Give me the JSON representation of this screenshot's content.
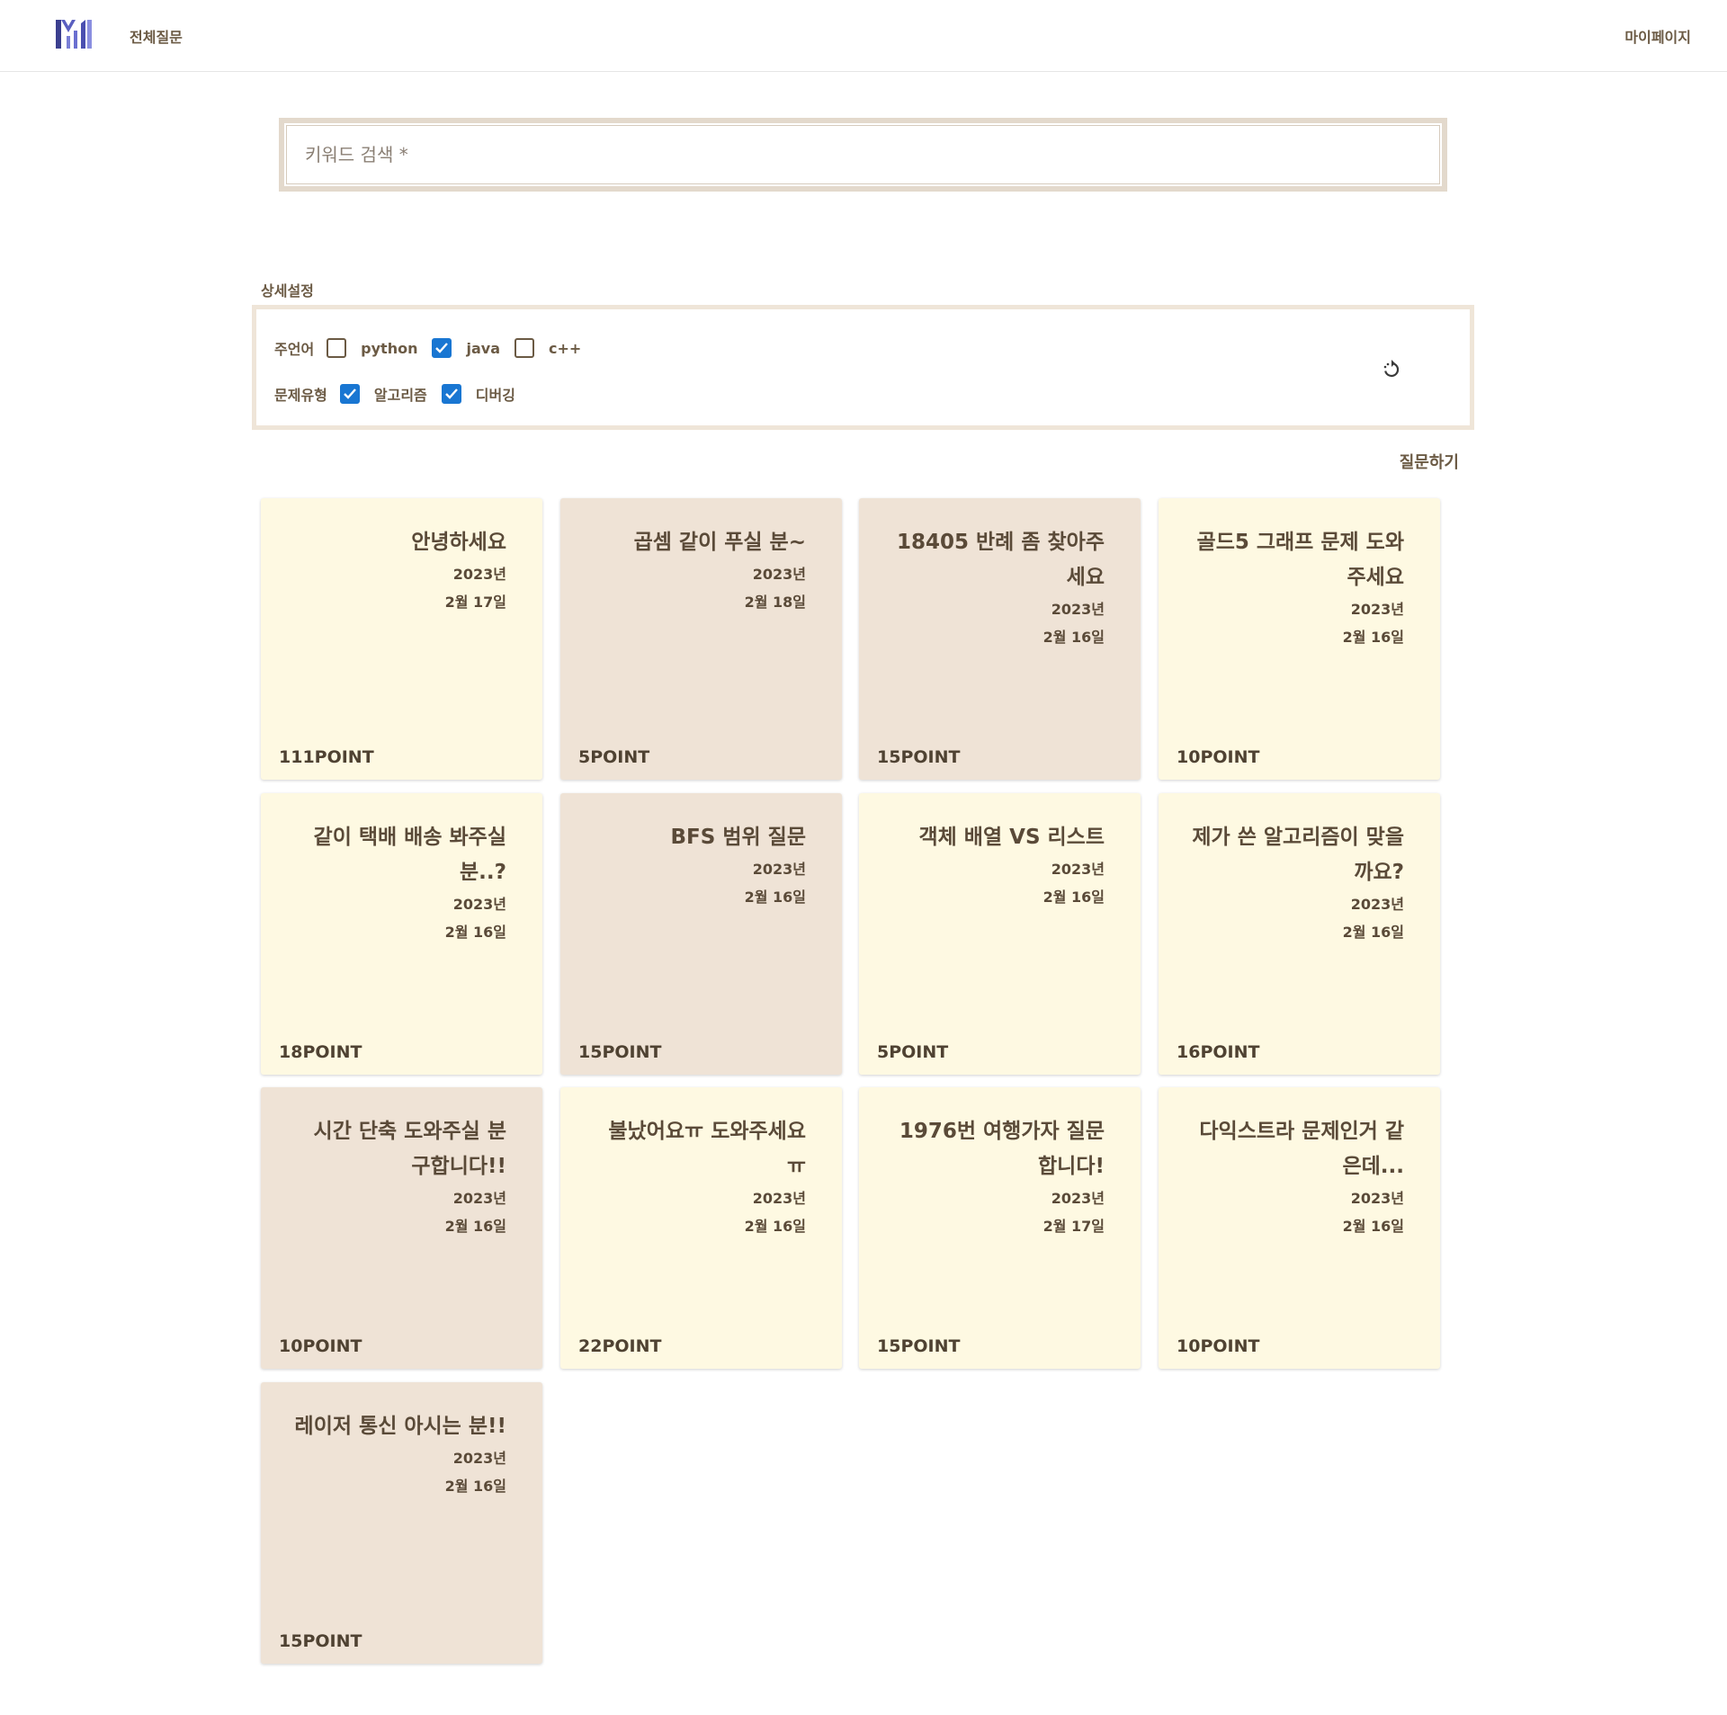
{
  "header": {
    "nav_all": "전체질문",
    "nav_mypage": "마이페이지"
  },
  "search": {
    "placeholder": "키워드 검색 *"
  },
  "filters": {
    "title": "상세설정",
    "language_label": "주언어",
    "languages": [
      {
        "label": "python",
        "checked": false
      },
      {
        "label": "java",
        "checked": true
      },
      {
        "label": "c++",
        "checked": false
      }
    ],
    "type_label": "문제유형",
    "types": [
      {
        "label": "알고리즘",
        "checked": true
      },
      {
        "label": "디버깅",
        "checked": true
      }
    ]
  },
  "ask_button": "질문하기",
  "colors": {
    "card_yellow": "#fef9e2",
    "card_beige": "#efe3d6",
    "checkbox_checked": "#1976d2"
  },
  "cards": [
    {
      "title": "안녕하세요",
      "year": "2023년",
      "date": "2월 17일",
      "points": "111POINT",
      "color": "yellow"
    },
    {
      "title": "곱셈 같이 푸실 분~",
      "year": "2023년",
      "date": "2월 18일",
      "points": "5POINT",
      "color": "beige"
    },
    {
      "title": "18405 반례 좀 찾아주세요",
      "year": "2023년",
      "date": "2월 16일",
      "points": "15POINT",
      "color": "beige"
    },
    {
      "title": "골드5 그래프 문제 도와주세요",
      "year": "2023년",
      "date": "2월 16일",
      "points": "10POINT",
      "color": "yellow"
    },
    {
      "title": "같이 택배 배송 봐주실 분..?",
      "year": "2023년",
      "date": "2월 16일",
      "points": "18POINT",
      "color": "yellow"
    },
    {
      "title": "BFS 범위 질문",
      "year": "2023년",
      "date": "2월 16일",
      "points": "15POINT",
      "color": "beige"
    },
    {
      "title": "객체 배열 VS 리스트",
      "year": "2023년",
      "date": "2월 16일",
      "points": "5POINT",
      "color": "yellow"
    },
    {
      "title": "제가 쓴 알고리즘이 맞을까요?",
      "year": "2023년",
      "date": "2월 16일",
      "points": "16POINT",
      "color": "yellow"
    },
    {
      "title": "시간 단축 도와주실 분 구합니다!!",
      "year": "2023년",
      "date": "2월 16일",
      "points": "10POINT",
      "color": "beige"
    },
    {
      "title": "불났어요ㅠ 도와주세요ㅠ",
      "year": "2023년",
      "date": "2월 16일",
      "points": "22POINT",
      "color": "yellow"
    },
    {
      "title": "1976번 여행가자 질문합니다!",
      "year": "2023년",
      "date": "2월 17일",
      "points": "15POINT",
      "color": "yellow"
    },
    {
      "title": "다익스트라 문제인거 같은데...",
      "year": "2023년",
      "date": "2월 16일",
      "points": "10POINT",
      "color": "yellow"
    },
    {
      "title": "레이저 통신 아시는 분!!",
      "year": "2023년",
      "date": "2월 16일",
      "points": "15POINT",
      "color": "beige"
    }
  ]
}
